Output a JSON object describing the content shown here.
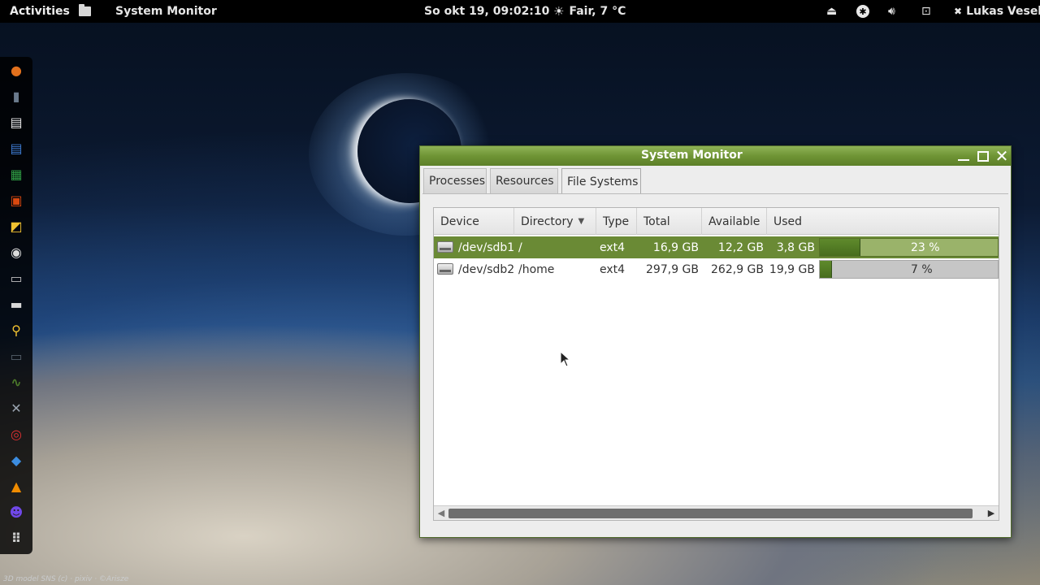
{
  "top_panel": {
    "activities": "Activities",
    "app_icon": "files-icon",
    "app_name": "System Monitor",
    "clock": "So okt 19, 09:02:10",
    "weather": "Fair, 7 °C",
    "weather_icon": "sun-icon",
    "tray": [
      "eject-icon",
      "accessibility-icon",
      "volume-icon",
      "network-icon"
    ],
    "user": "Lukas Vesel"
  },
  "dock": {
    "items": [
      {
        "name": "firefox-icon",
        "color": "#e2711d"
      },
      {
        "name": "cellphone-icon",
        "color": "#6a7a8c"
      },
      {
        "name": "libreoffice-icon",
        "color": "#e8e8e8"
      },
      {
        "name": "writer-icon",
        "color": "#3d7bd1"
      },
      {
        "name": "calc-icon",
        "color": "#2f9e44"
      },
      {
        "name": "impress-icon",
        "color": "#d9480f"
      },
      {
        "name": "draw-icon",
        "color": "#f2c230"
      },
      {
        "name": "webcam-icon",
        "color": "#dcdcdc"
      },
      {
        "name": "archive-icon",
        "color": "#bfbfbf"
      },
      {
        "name": "file-manager-icon",
        "color": "#d8d8d8"
      },
      {
        "name": "search-icon",
        "color": "#f2c230"
      },
      {
        "name": "terminal-icon",
        "color": "#555f6a"
      },
      {
        "name": "system-monitor-icon",
        "color": "#4c7a2a"
      },
      {
        "name": "tools-icon",
        "color": "#9aa4b0"
      },
      {
        "name": "help-icon",
        "color": "#e03131"
      },
      {
        "name": "dropbox-icon",
        "color": "#3c8de0"
      },
      {
        "name": "vlc-icon",
        "color": "#f08c00"
      },
      {
        "name": "chat-icon",
        "color": "#7048e8"
      },
      {
        "name": "app-grid-icon",
        "color": "#cccccc"
      }
    ]
  },
  "window": {
    "title": "System Monitor",
    "tabs": [
      "Processes",
      "Resources",
      "File Systems"
    ],
    "active_tab": "File Systems",
    "columns": [
      "Device",
      "Directory",
      "Type",
      "Total",
      "Available",
      "Used"
    ],
    "rows": [
      {
        "device": "/dev/sdb1",
        "directory": "/",
        "type": "ext4",
        "total": "16,9 GB",
        "available": "12,2 GB",
        "used": "3,8 GB",
        "percent_label": "23 %",
        "percent": 23,
        "selected": true
      },
      {
        "device": "/dev/sdb2",
        "directory": "/home",
        "type": "ext4",
        "total": "297,9 GB",
        "available": "262,9 GB",
        "used": "19,9 GB",
        "percent_label": "7 %",
        "percent": 7,
        "selected": false
      }
    ]
  },
  "credit": "3D model SNS (c) · pixiv · ©Arisze"
}
